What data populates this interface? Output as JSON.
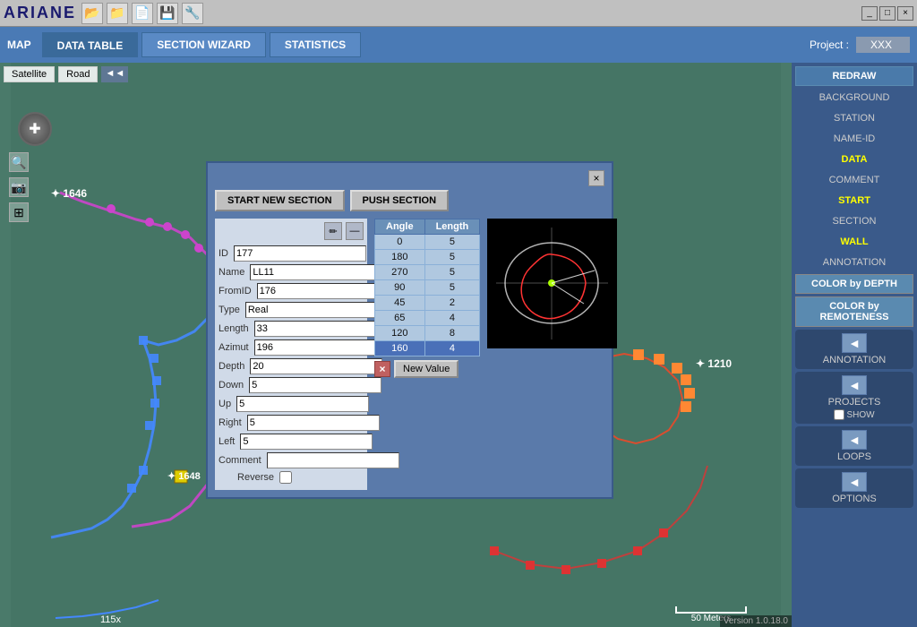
{
  "titleBar": {
    "appName": "ARIANE",
    "controls": [
      "_",
      "□",
      "×"
    ],
    "toolbarIcons": [
      "folder-open",
      "folder",
      "new",
      "save",
      "settings"
    ]
  },
  "navBar": {
    "mapLabel": "MAP",
    "tabs": [
      {
        "label": "DATA TABLE",
        "active": false
      },
      {
        "label": "SECTION WIZARD",
        "active": false
      },
      {
        "label": "STATISTICS",
        "active": false
      }
    ],
    "projectLabel": "Project :",
    "projectValue": "XXX"
  },
  "mapControls": {
    "satelliteBtn": "Satellite",
    "roadBtn": "Road",
    "collapseBtn": "◄◄"
  },
  "scaleBar": {
    "label": "50 Meters"
  },
  "version": "Version 1.0.18.0",
  "rightSidebar": {
    "redrawBtn": "REDRAW",
    "items": [
      {
        "label": "BACKGROUND",
        "type": "plain"
      },
      {
        "label": "STATION",
        "type": "plain"
      },
      {
        "label": "NAME-ID",
        "type": "plain"
      },
      {
        "label": "DATA",
        "type": "highlight"
      },
      {
        "label": "COMMENT",
        "type": "plain"
      },
      {
        "label": "START",
        "type": "highlight"
      },
      {
        "label": "SECTION",
        "type": "plain"
      },
      {
        "label": "WALL",
        "type": "highlight"
      },
      {
        "label": "ANNOTATION",
        "type": "plain"
      }
    ],
    "colorByDepthBtn": "COLOR by DEPTH",
    "colorByRemotenessBtn": "COLOR by REMOTENESS",
    "groups": [
      {
        "chevron": "◄",
        "label": "ANNOTATION"
      },
      {
        "chevron": "◄",
        "label": "PROJECTS",
        "showCheckbox": true
      },
      {
        "chevron": "◄",
        "label": "LOOPS"
      },
      {
        "chevron": "◄",
        "label": "OPTIONS"
      }
    ]
  },
  "modal": {
    "startNewSectionBtn": "START NEW SECTION",
    "pushSectionBtn": "PUSH SECTION",
    "closeBtn": "×",
    "form": {
      "editIcon": "✏",
      "minusIcon": "—",
      "fields": [
        {
          "label": "ID",
          "value": "177"
        },
        {
          "label": "Name",
          "value": "LL11"
        },
        {
          "label": "FromID",
          "value": "176"
        },
        {
          "label": "Type",
          "value": "Real"
        },
        {
          "label": "Length",
          "value": "33"
        },
        {
          "label": "Azimut",
          "value": "196"
        },
        {
          "label": "Depth",
          "value": "20"
        },
        {
          "label": "Down",
          "value": "5"
        },
        {
          "label": "Up",
          "value": "5"
        },
        {
          "label": "Right",
          "value": "5"
        },
        {
          "label": "Left",
          "value": "5"
        },
        {
          "label": "Comment",
          "value": ""
        },
        {
          "label": "Reverse",
          "type": "checkbox",
          "value": false
        }
      ]
    },
    "table": {
      "headers": [
        "Angle",
        "Length"
      ],
      "rows": [
        {
          "angle": "0",
          "length": "5",
          "selected": false
        },
        {
          "angle": "180",
          "length": "5",
          "selected": false
        },
        {
          "angle": "270",
          "length": "5",
          "selected": false
        },
        {
          "angle": "90",
          "length": "5",
          "selected": false
        },
        {
          "angle": "45",
          "length": "2",
          "selected": false
        },
        {
          "angle": "65",
          "length": "4",
          "selected": false
        },
        {
          "angle": "120",
          "length": "8",
          "selected": false
        },
        {
          "angle": "160",
          "length": "4",
          "selected": true
        }
      ],
      "deleteBtnLabel": "×",
      "newValueBtn": "New Value"
    }
  },
  "mapNodes": {
    "label1": "1646",
    "label2": "1210",
    "label3": "1648"
  }
}
